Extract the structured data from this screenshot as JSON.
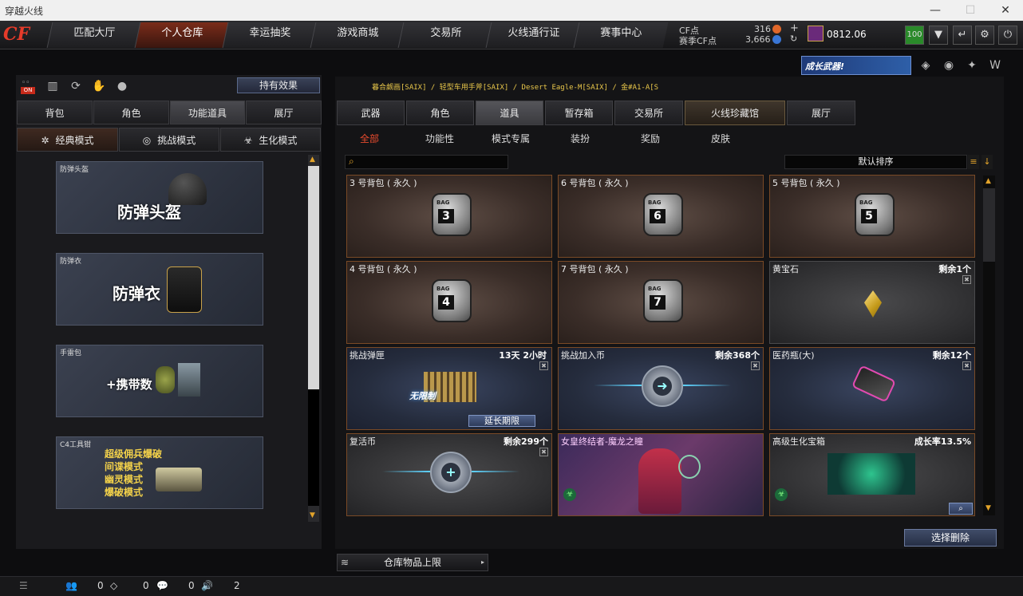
{
  "window": {
    "title": "穿越火线"
  },
  "nav": {
    "tabs": [
      "匹配大厅",
      "个人仓库",
      "幸运抽奖",
      "游戏商城",
      "交易所",
      "火线通行证",
      "赛事中心"
    ],
    "active": 1,
    "cf_label": "CF点",
    "cf_value": "316",
    "sscf_label": "赛季CF点",
    "sscf_value": "3,666",
    "user_id": "0812.06",
    "level": "100"
  },
  "banner": {
    "text": "成长武器!"
  },
  "left": {
    "hold_effect": "持有效果",
    "on_badge": "ON",
    "tabs": [
      "背包",
      "角色",
      "功能道具",
      "展厅"
    ],
    "active_tab": 2,
    "modes": [
      "经典模式",
      "挑战模式",
      "生化模式"
    ],
    "active_mode": 0,
    "slots": [
      {
        "label": "防弹头盔",
        "name": "防弹头盔"
      },
      {
        "label": "防弹衣",
        "name": "防弹衣"
      },
      {
        "label": "手雷包",
        "name": "+携带数"
      },
      {
        "label": "C4工具钳",
        "lines": [
          "超级佣兵爆破",
          "间谍模式",
          "幽灵模式",
          "爆破模式"
        ]
      }
    ]
  },
  "right": {
    "ticker": "暮合觑画[SAIX] / 轻型车用手斧[SAIX] / Desert Eagle-M[SAIX] / 金#A1-A[S",
    "tabs": [
      "武器",
      "角色",
      "道具",
      "暂存箱",
      "交易所",
      "火线珍藏馆",
      "展厅"
    ],
    "active_tab": 2,
    "subtabs": [
      "全部",
      "功能性",
      "模式专属",
      "装扮",
      "奖励",
      "皮肤"
    ],
    "active_subtab": 0,
    "sort_label": "默认排序",
    "items": [
      {
        "name": "3 号背包 ( 永久 )",
        "right": "",
        "num": "3"
      },
      {
        "name": "6 号背包 ( 永久 )",
        "right": "",
        "num": "6"
      },
      {
        "name": "5 号背包 ( 永久 )",
        "right": "",
        "num": "5"
      },
      {
        "name": "4 号背包 ( 永久 )",
        "right": "",
        "num": "4"
      },
      {
        "name": "7 号背包 ( 永久 )",
        "right": "",
        "num": "7"
      },
      {
        "name": "黄宝石",
        "right": "剩余1个"
      },
      {
        "name": "挑战弹匣",
        "right": "13天 2小时",
        "art": "无限制",
        "extend": "延长期限"
      },
      {
        "name": "挑战加入币",
        "right": "剩余368个"
      },
      {
        "name": "医药瓶(大)",
        "right": "剩余12个"
      },
      {
        "name": "复活币",
        "right": "剩余299个"
      },
      {
        "name": "女皇终结者-魔龙之瞳",
        "right": ""
      },
      {
        "name": "高级生化宝箱",
        "right": "成长率13.5%"
      }
    ],
    "select_delete": "选择删除",
    "limit": "仓库物品上限"
  },
  "status": {
    "v1": "0",
    "v2": "0",
    "v3": "0",
    "v4": "2"
  }
}
